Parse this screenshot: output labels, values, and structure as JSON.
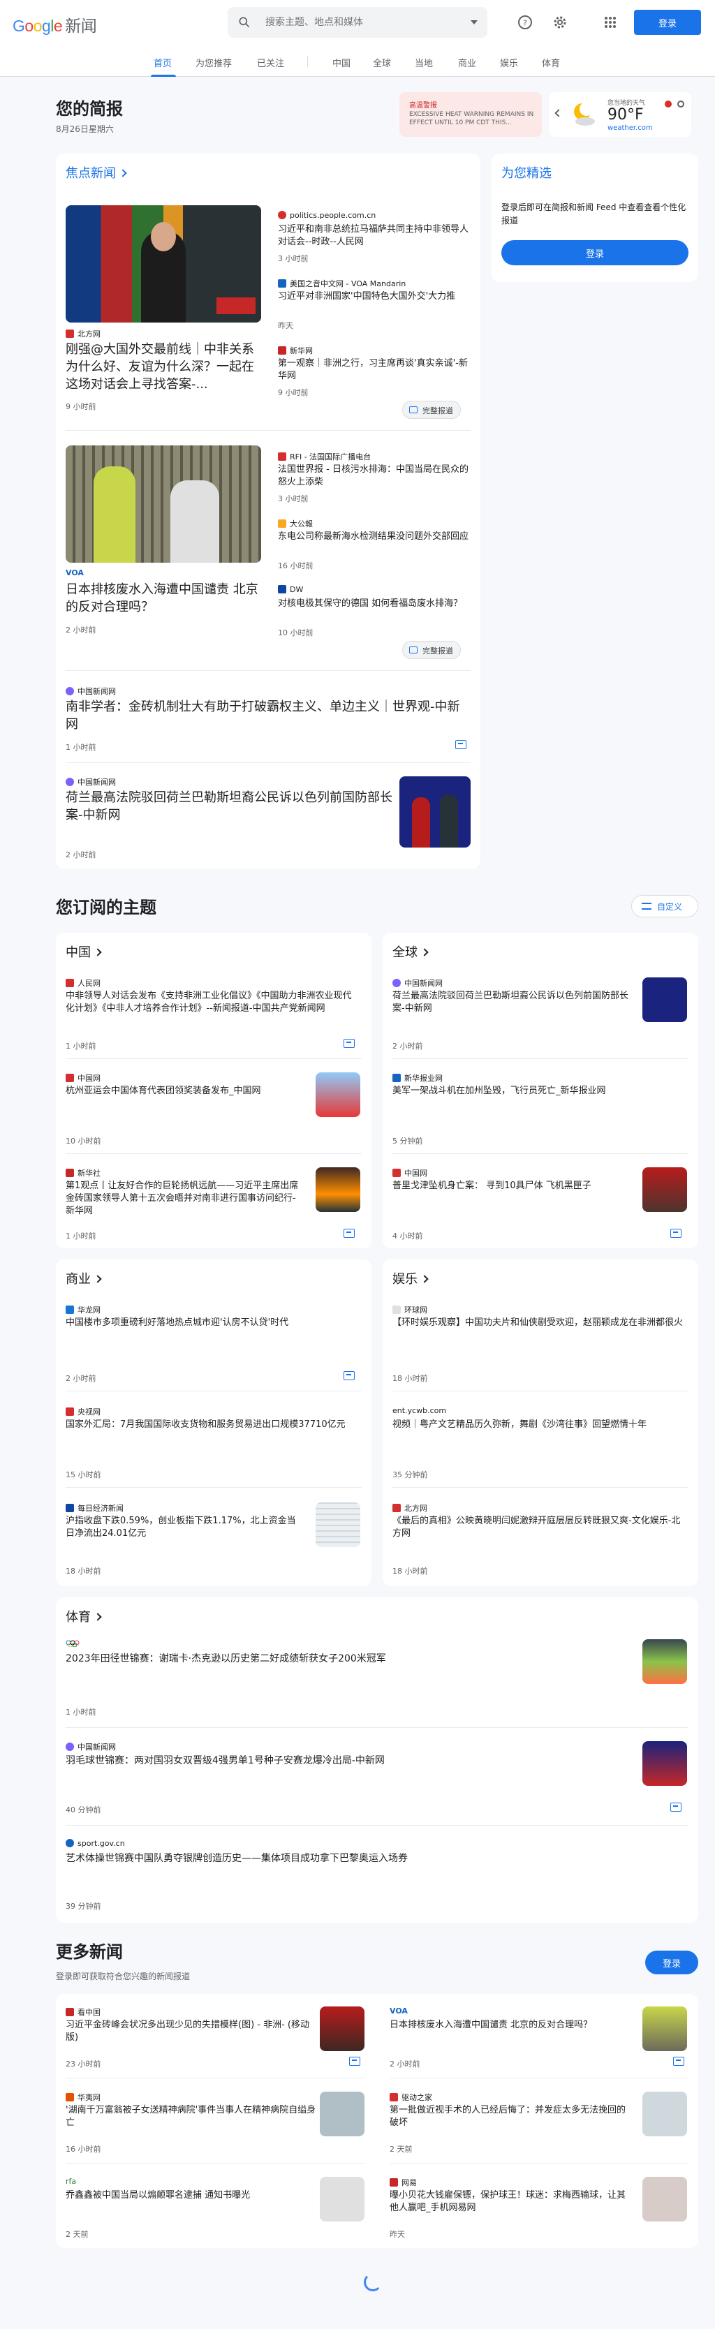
{
  "header": {
    "logo_google": "Google",
    "logo_news": "新闻",
    "search_placeholder": "搜索主题、地点和媒体",
    "signin": "登录",
    "icons": [
      "search-icon",
      "help-icon",
      "settings-icon",
      "apps-icon"
    ]
  },
  "nav": {
    "tabs": [
      {
        "label": "首页",
        "active": true
      },
      {
        "label": "为您推荐",
        "active": false
      },
      {
        "label": "已关注",
        "active": false
      },
      {
        "label": "中国",
        "active": false
      },
      {
        "label": "全球",
        "active": false
      },
      {
        "label": "当地",
        "active": false
      },
      {
        "label": "商业",
        "active": false
      },
      {
        "label": "娱乐",
        "active": false
      },
      {
        "label": "体育",
        "active": false
      }
    ]
  },
  "briefing": {
    "title": "您的简报",
    "date": "8月26日星期六",
    "alert": {
      "label": "高温警报",
      "text": "EXCESSIVE HEAT WARNING REMAINS IN EFFECT UNTIL 10 PM CDT THIS..."
    },
    "weather": {
      "label": "您当地的天气",
      "temp": "90°F",
      "source": "weather.com"
    }
  },
  "top_stories": {
    "heading": "焦点新闻",
    "clusters": [
      {
        "main": {
          "source": "北方网",
          "headline": "刚强@大国外交最前线｜中非关系为什么好、友谊为什么深？一起在这场对话会上寻找答案-...",
          "time": "9 小时前"
        },
        "side": [
          {
            "source": "politics.people.com.cn",
            "headline": "习近平和南非总统拉马福萨共同主持中非领导人对话会--时政--人民网",
            "time": "3 小时前"
          },
          {
            "source": "美国之音中文网 - VOA Mandarin",
            "headline": "习近平对非洲国家'中国特色大国外交'大力推",
            "time": "昨天"
          },
          {
            "source": "新华网",
            "headline": "第一观察｜非洲之行，习主席再谈'真实亲诚'-新华网",
            "time": "9 小时前"
          }
        ],
        "full_coverage": "完整报道"
      },
      {
        "main": {
          "source": "VOA",
          "headline": "日本排核废水入海遭中国谴责 北京的反对合理吗？",
          "time": "2 小时前"
        },
        "side": [
          {
            "source": "RFI - 法国国际广播电台",
            "headline": "法国世界报 - 日核污水排海：中国当局在民众的怒火上添柴",
            "time": "3 小时前"
          },
          {
            "source": "大公報",
            "headline": "东电公司称最新海水检测结果没问题外交部回应",
            "time": "16 小时前"
          },
          {
            "source": "DW",
            "headline": "对核电极其保守的德国 如何看福岛废水排海？",
            "time": "10 小时前"
          }
        ],
        "full_coverage": "完整报道"
      }
    ],
    "single": [
      {
        "source": "中国新闻网",
        "headline": "南非学者：金砖机制壮大有助于打破霸权主义、单边主义｜世界观-中新网",
        "time": "1 小时前"
      },
      {
        "source": "中国新闻网",
        "headline": "荷兰最高法院驳回荷兰巴勒斯坦裔公民诉以色列前国防部长案-中新网",
        "time": "2 小时前"
      }
    ]
  },
  "picks": {
    "title": "为您精选",
    "text": "登录后即可在简报和新闻 Feed 中查看查看个性化报道",
    "signin": "登录"
  },
  "subscribed": {
    "title": "您订阅的主题",
    "customize": "自定义",
    "topics": [
      {
        "name": "中国",
        "items": [
          {
            "source": "人民网",
            "headline": "中非领导人对话会发布《支持非洲工业化倡议》《中国助力非洲农业现代化计划》《中非人才培养合作计划》--新闻报道-中国共产党新闻网",
            "time": "1 小时前"
          },
          {
            "source": "中国网",
            "headline": "杭州亚运会中国体育代表团领奖装备发布_中国网",
            "time": "10 小时前"
          },
          {
            "source": "新华社",
            "headline": "第1观点丨让友好合作的巨轮扬帆远航——习近平主席出席金砖国家领导人第十五次会晤并对南非进行国事访问纪行-新华网",
            "time": "1 小时前"
          }
        ]
      },
      {
        "name": "全球",
        "items": [
          {
            "source": "中国新闻网",
            "headline": "荷兰最高法院驳回荷兰巴勒斯坦裔公民诉以色列前国防部长案-中新网",
            "time": "2 小时前"
          },
          {
            "source": "新华报业网",
            "headline": "美军一架战斗机在加州坠毁，飞行员死亡_新华报业网",
            "time": "5 分钟前"
          },
          {
            "source": "中国网",
            "headline": "普里戈津坠机身亡案： 寻到10具尸体 飞机黑匣子",
            "time": "4 小时前"
          }
        ]
      },
      {
        "name": "商业",
        "items": [
          {
            "source": "华龙网",
            "headline": "中国楼市多项重磅利好落地热点城市迎'认房不认贷'时代",
            "time": "2 小时前"
          },
          {
            "source": "央视网",
            "headline": "国家外汇局：7月我国国际收支货物和服务贸易进出口规模37710亿元",
            "time": "15 小时前"
          },
          {
            "source": "每日经济新闻",
            "headline": "沪指收盘下跌0.59%，创业板指下跌1.17%，北上资金当日净流出24.01亿元",
            "time": "18 小时前"
          }
        ]
      },
      {
        "name": "娱乐",
        "items": [
          {
            "source": "环球网",
            "headline": "【环时娱乐观察】中国功夫片和仙侠剧受欢迎，赵丽颖成龙在非洲都很火",
            "time": "18 小时前"
          },
          {
            "source": "ent.ycwb.com",
            "headline": "视频｜粤产文艺精品历久弥新，舞剧《沙湾往事》回望燃情十年",
            "time": "35 分钟前"
          },
          {
            "source": "北方网",
            "headline": "《最后的真相》公映黄晓明闫妮激辩开庭层层反转既狠又爽-文化娱乐-北方网",
            "time": "18 小时前"
          }
        ]
      }
    ],
    "sports": {
      "name": "体育",
      "items": [
        {
          "source": "Olympics",
          "headline": "2023年田径世锦赛：谢瑞卡·杰克逊以历史第二好成绩斩获女子200米冠军",
          "time": "1 小时前"
        },
        {
          "source": "中国新闻网",
          "headline": "羽毛球世锦赛：两对国羽女双晋级4强男单1号种子安赛龙爆冷出局-中新网",
          "time": "40 分钟前"
        },
        {
          "source": "sport.gov.cn",
          "headline": "艺术体操世锦赛中国队勇夺银牌创造历史——集体项目成功拿下巴黎奥运入场券",
          "time": "39 分钟前"
        }
      ]
    }
  },
  "more_news": {
    "title": "更多新闻",
    "subtitle": "登录即可获取符合您兴趣的新闻报道",
    "signin": "登录",
    "items": [
      {
        "source": "看中国",
        "headline": "习近平金砖峰会状况多出现少见的失措模样(图) - 非洲- (移动版)",
        "time": "23 小时前"
      },
      {
        "source": "VOA",
        "headline": "日本排核废水入海遭中国谴责 北京的反对合理吗？",
        "time": "2 小时前"
      },
      {
        "source": "华夷网",
        "headline": "'湖南千万富翁被子女送精神病院'事件当事人在精神病院自缢身亡",
        "time": "16 小时前"
      },
      {
        "source": "驱动之家",
        "headline": "第一批做近视手术的人已经后悔了：并发症太多无法挽回的破坏",
        "time": "2 天前"
      },
      {
        "source": "rfa",
        "headline": "乔鑫鑫被中国当局以煽颠罪名逮捕 通知书曝光",
        "time": "2 天前"
      },
      {
        "source": "网易",
        "headline": "曝小贝花大钱雇保镖，保护球王！球迷：求梅西输球，让其他人赢吧_手机网易网",
        "time": "昨天"
      }
    ]
  },
  "colors": {
    "accent": "#1a73e8",
    "alert_bg": "#fce8e6",
    "alert_text": "#c5221f",
    "page_bg": "#f6f8fc"
  }
}
